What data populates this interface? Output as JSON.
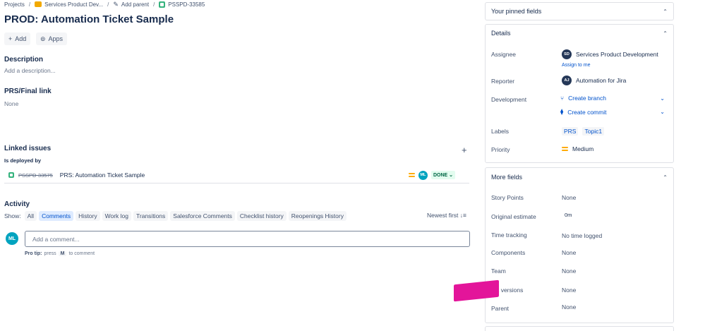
{
  "breadcrumb": {
    "projects": "Projects",
    "space": "Services Product Dev...",
    "add_parent": "Add parent",
    "issue_key": "PSSPD-33585"
  },
  "issue": {
    "title": "PROD: Automation Ticket Sample"
  },
  "toolbar": {
    "add_label": "Add",
    "apps_label": "Apps"
  },
  "description": {
    "heading": "Description",
    "placeholder": "Add a description..."
  },
  "prs_link": {
    "heading": "PRS/Final link",
    "value": "None"
  },
  "linked_issues": {
    "heading": "Linked issues",
    "relation": "Is deployed by",
    "items": [
      {
        "key": "PSSPD-33575",
        "summary": "PRS: Automation Ticket Sample",
        "priority_icon": "priority-medium-icon",
        "assignee_initials": "ML",
        "status": "DONE"
      }
    ]
  },
  "activity": {
    "heading": "Activity",
    "show_label": "Show:",
    "tabs": [
      "All",
      "Comments",
      "History",
      "Work log",
      "Transitions",
      "Salesforce Comments",
      "Checklist history",
      "Reopenings History"
    ],
    "selected_tab": "Comments",
    "sort_label": "Newest first",
    "user_initials": "ML",
    "comment_placeholder": "Add a comment...",
    "protip_label": "Pro tip:",
    "protip_press": "press",
    "protip_key": "M",
    "protip_suffix": "to comment"
  },
  "pinned": {
    "heading": "Your pinned fields"
  },
  "details": {
    "heading": "Details",
    "assignee_label": "Assignee",
    "assignee_initials": "SD",
    "assignee_name": "Services Product Development",
    "assign_to_me": "Assign to me",
    "reporter_label": "Reporter",
    "reporter_initials": "AJ",
    "reporter_name": "Automation for Jira",
    "development_label": "Development",
    "create_branch": "Create branch",
    "create_commit": "Create commit",
    "labels_label": "Labels",
    "labels": [
      "PRS",
      "Topic1"
    ],
    "priority_label": "Priority",
    "priority_value": "Medium"
  },
  "more_fields": {
    "heading": "More fields",
    "story_points_label": "Story Points",
    "story_points_value": "None",
    "original_estimate_label": "Original estimate",
    "original_estimate_value": "0m",
    "time_tracking_label": "Time tracking",
    "time_tracking_value": "No time logged",
    "components_label": "Components",
    "components_value": "None",
    "team_label": "Team",
    "team_value": "None",
    "fix_versions_label": "Fix versions",
    "fix_versions_value": "None",
    "parent_label": "Parent",
    "parent_value": "None"
  },
  "colors": {
    "accent": "#0052cc",
    "done_green": "#006644",
    "annotation_pink": "#e3159a"
  }
}
